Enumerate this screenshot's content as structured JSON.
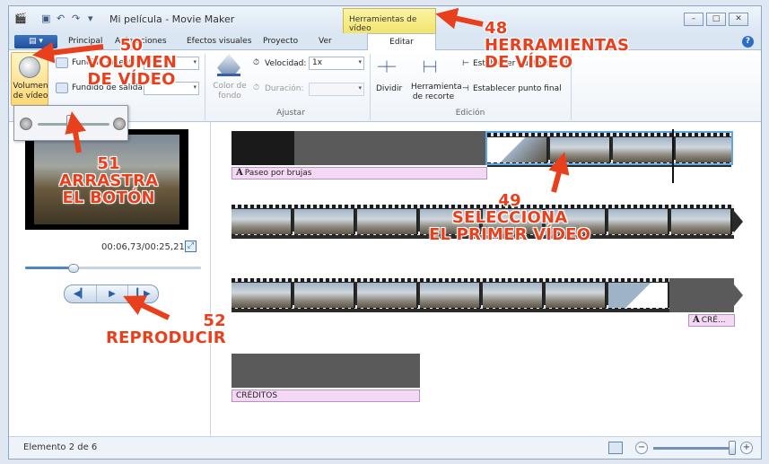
{
  "titlebar": {
    "document_title": "Mi película - Movie Maker",
    "context_tab": "Herramientas de vídeo"
  },
  "tabs": {
    "file_button": "▤ ▾",
    "items": [
      "Principal",
      "Animaciones",
      "Efectos visuales",
      "Proyecto",
      "Ver"
    ],
    "active": "Editar"
  },
  "ribbon": {
    "volume_label": "Volumen de vídeo",
    "fundido_entrada": "Fundido de entrada:",
    "fundido_salida": "Fundido de salida:",
    "color_fondo": "Color de fondo",
    "velocidad_label": "Velocidad:",
    "velocidad_value": "1x",
    "duracion_label": "Duración:",
    "dividir": "Dividir",
    "herramienta_recorte": "Herramienta de recorte",
    "establecer_inicio": "Establecer punto inicial",
    "establecer_final": "Establecer punto final",
    "group_ajustar": "Ajustar",
    "group_edicion": "Edición"
  },
  "preview": {
    "time": "00:06,73/00:25,21",
    "seek_fraction": 0.27
  },
  "storyboard": {
    "caption_1": "Paseo por brujas",
    "caption_credits_small": "CRÉ...",
    "caption_credits": "CRÉDITOS"
  },
  "status": {
    "text": "Elemento 2 de 6",
    "zoom_fraction": 1.0
  },
  "annotations": {
    "a48": "48\nHERRAMIENTAS\nDE VÍDEO",
    "a49": "49\nSELECCIONA\nEL PRIMER VÍDEO",
    "a50": "50\nVOLUMEN\nDE VÍDEO",
    "a51": "51\nARRASTRA\nEL BOTÓN",
    "a52": "52\nREPRODUCIR"
  },
  "colors": {
    "annotation": "#e8401c",
    "context_tab": "#f2e46d",
    "selection": "#5aa8e6",
    "caption": "#f4d9f4"
  }
}
